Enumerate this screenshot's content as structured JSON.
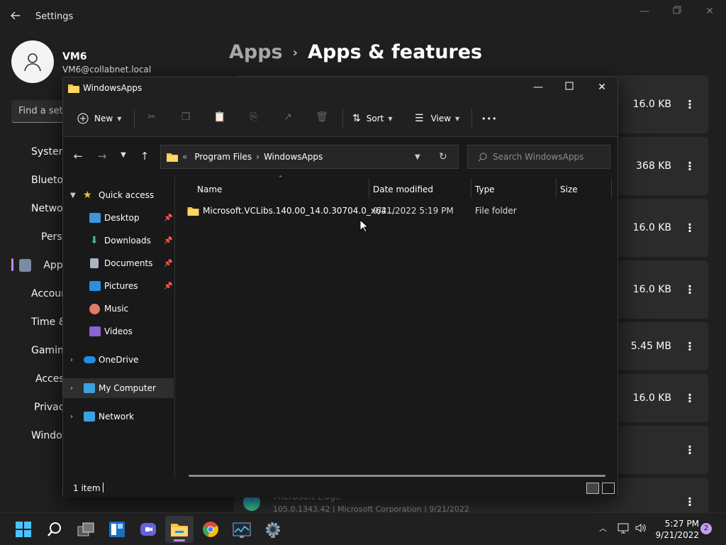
{
  "settings": {
    "title": "Settings",
    "user": {
      "name": "VM6",
      "email": "VM6@collabnet.local"
    },
    "search_placeholder": "Find a setting",
    "nav": [
      {
        "label": "System",
        "icon": "monitor-icon",
        "color": "#3a96dd"
      },
      {
        "label": "Bluetooth & devices",
        "icon": "bluetooth-icon",
        "color": "#0078d4"
      },
      {
        "label": "Network & internet",
        "icon": "wifi-icon",
        "color": "#4cc2ff"
      },
      {
        "label": "Personalization",
        "icon": "brush-icon",
        "color": "#e8a87c"
      },
      {
        "label": "Apps",
        "icon": "apps-icon",
        "color": "#7a8ca0"
      },
      {
        "label": "Accounts",
        "icon": "person-icon",
        "color": "#2fb58b"
      },
      {
        "label": "Time & language",
        "icon": "clock-globe-icon",
        "color": "#4cc2ff"
      },
      {
        "label": "Gaming",
        "icon": "gamepad-icon",
        "color": "#aaaaaa"
      },
      {
        "label": "Accessibility",
        "icon": "accessibility-icon",
        "color": "#4cc2ff"
      },
      {
        "label": "Privacy & security",
        "icon": "shield-icon",
        "color": "#8a8a8a"
      },
      {
        "label": "Windows Update",
        "icon": "update-icon",
        "color": "#4cc2ff"
      }
    ],
    "breadcrumb": {
      "parent": "Apps",
      "separator": "›",
      "current": "Apps & features"
    },
    "app_sizes": [
      "16.0 KB",
      "368 KB",
      "16.0 KB",
      "16.0 KB",
      "5.45 MB",
      "16.0 KB",
      "",
      ""
    ],
    "more_glyph": "⋮",
    "edge_row": {
      "name": "Microsoft Edge",
      "details": "105.0.1343.42  |  Microsoft Corporation  |  9/21/2022"
    }
  },
  "explorer": {
    "title": "WindowsApps",
    "toolbar": {
      "new_label": "New",
      "sort_label": "Sort",
      "view_label": "View",
      "more_label": "•••"
    },
    "address": {
      "prefix": "«",
      "crumbs": [
        "Program Files",
        "WindowsApps"
      ],
      "separator": "›"
    },
    "search_placeholder": "Search WindowsApps",
    "tree": {
      "quick_access": "Quick access",
      "pinned": [
        "Desktop",
        "Downloads",
        "Documents",
        "Pictures"
      ],
      "unpinned": [
        "Music",
        "Videos"
      ],
      "onedrive": "OneDrive",
      "my_computer": "My Computer",
      "network": "Network"
    },
    "columns": {
      "name": "Name",
      "date": "Date modified",
      "type": "Type",
      "size": "Size"
    },
    "files": [
      {
        "name": "Microsoft.VCLibs.140.00_14.0.30704.0_x64...",
        "date": "9/21/2022 5:19 PM",
        "type": "File folder",
        "size": ""
      }
    ],
    "status": {
      "count": "1 item"
    }
  },
  "taskbar": {
    "time": "5:27 PM",
    "date": "9/21/2022",
    "notifications": "2"
  }
}
